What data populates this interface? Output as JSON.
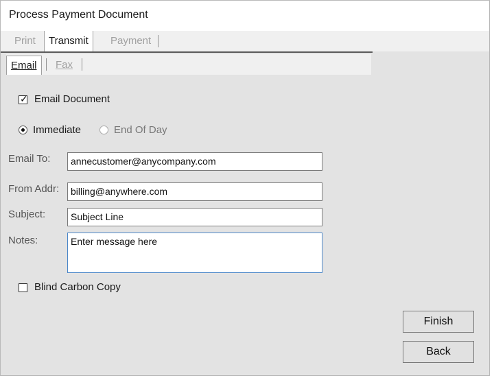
{
  "window": {
    "title": "Process Payment Document"
  },
  "tabs_top": [
    {
      "label": "Print",
      "state": "disabled"
    },
    {
      "label": "Transmit",
      "state": "active"
    },
    {
      "label": "Payment",
      "state": "disabled"
    }
  ],
  "tabs_sub": [
    {
      "label": "Email",
      "state": "active"
    },
    {
      "label": "Fax",
      "state": "disabled"
    }
  ],
  "email_document": {
    "label": "Email Document",
    "checked": true
  },
  "timing": {
    "immediate": {
      "label": "Immediate",
      "selected": true
    },
    "end_of_day": {
      "label": "End Of Day",
      "selected": false
    }
  },
  "form": {
    "email_to": {
      "label": "Email To:",
      "value": "annecustomer@anycompany.com"
    },
    "from_addr": {
      "label": "From Addr:",
      "value": "billing@anywhere.com"
    },
    "subject": {
      "label": "Subject:",
      "value": "Subject Line"
    },
    "notes": {
      "label": "Notes:",
      "value": "Enter message here"
    }
  },
  "blind_carbon_copy": {
    "label": "Blind Carbon Copy",
    "checked": false
  },
  "buttons": {
    "finish": "Finish",
    "back": "Back"
  },
  "colors": {
    "panel": "#e3e3e3",
    "tab_active": "#ffffff",
    "focus_border": "#4a86c8"
  }
}
